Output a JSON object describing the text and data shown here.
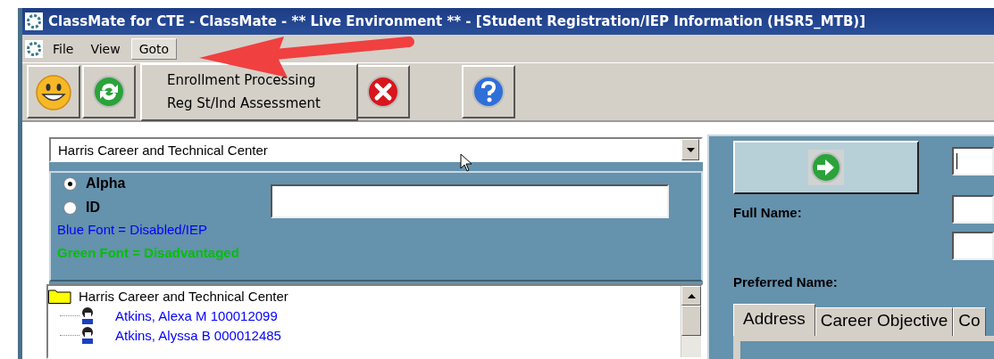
{
  "window": {
    "title": "ClassMate for CTE - ClassMate - ** Live Environment ** - [Student Registration/IEP Information (HSR5_MTB)]"
  },
  "menu": [
    {
      "label": "File",
      "selected": false
    },
    {
      "label": "View",
      "selected": false
    },
    {
      "label": "Goto",
      "selected": true
    }
  ],
  "goto_menu": {
    "items": [
      "Enrollment Processing",
      "Reg St/Ind Assessment"
    ]
  },
  "toolbar": [
    {
      "kind": "smiley"
    },
    {
      "kind": "refresh"
    },
    {
      "kind": "close"
    },
    {
      "kind": "help"
    }
  ],
  "school_select": {
    "value": "Harris Career and Technical Center"
  },
  "search_mode": [
    {
      "label": "Alpha",
      "selected": true
    },
    {
      "label": "ID",
      "selected": false
    }
  ],
  "legend": [
    {
      "text": "Blue Font = Disabled/IEP",
      "color": "#0000ff",
      "bold": false
    },
    {
      "text": "Green Font = Disadvantaged",
      "color": "#00c000",
      "bold": true
    }
  ],
  "tree": {
    "label": "Harris Career and Technical Center",
    "children": [
      {
        "label": "Atkins, Alexa M 100012099",
        "color": "#0000ff"
      },
      {
        "label": "Atkins, Alyssa B 000012485",
        "color": "#0000ff"
      }
    ]
  },
  "student": {
    "full_name_label": "Full Name:",
    "preferred_name_label": "Preferred Name:"
  },
  "tabs": [
    {
      "label": "Address",
      "selected": true
    },
    {
      "label": "Career Objective",
      "selected": false
    },
    {
      "label": "Co",
      "selected": false
    }
  ]
}
